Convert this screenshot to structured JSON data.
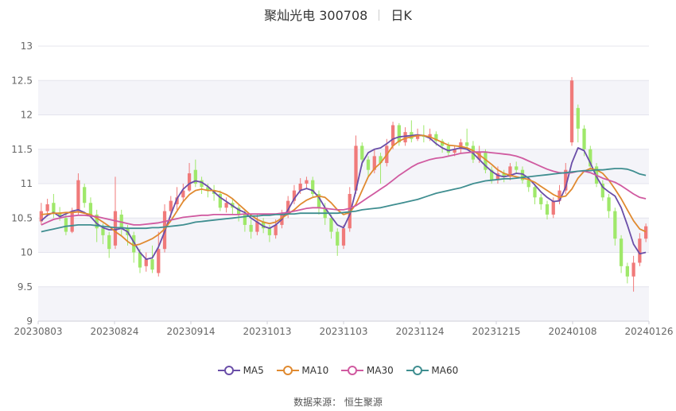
{
  "header": {
    "stock": "聚灿光电 300708",
    "period": "日K"
  },
  "footer": {
    "source_label": "数据来源：",
    "source_name": "恒生聚源"
  },
  "chart_data": {
    "type": "candlestick",
    "ylim": [
      9,
      13
    ],
    "yticks": [
      9,
      9.5,
      10,
      10.5,
      11,
      11.5,
      12,
      12.5,
      13
    ],
    "xticks": [
      "20230803",
      "20230824",
      "20230914",
      "20231013",
      "20231103",
      "20231124",
      "20231215",
      "20240108",
      "20240126"
    ],
    "grid": true,
    "legend_position": "bottom",
    "colors": {
      "up": "#f07a7a",
      "down": "#9fe86a",
      "grid": "#e4e4ee",
      "band": "#f4f4f9"
    },
    "candles": [
      [
        10.45,
        10.6,
        10.72,
        10.4
      ],
      [
        10.6,
        10.7,
        10.78,
        10.52
      ],
      [
        10.72,
        10.58,
        10.85,
        10.5
      ],
      [
        10.58,
        10.52,
        10.66,
        10.46
      ],
      [
        10.5,
        10.3,
        10.56,
        10.25
      ],
      [
        10.3,
        10.6,
        10.65,
        10.28
      ],
      [
        10.6,
        11.05,
        11.15,
        10.55
      ],
      [
        10.95,
        10.72,
        11.0,
        10.65
      ],
      [
        10.72,
        10.55,
        10.8,
        10.5
      ],
      [
        10.55,
        10.35,
        10.62,
        10.15
      ],
      [
        10.35,
        10.25,
        10.42,
        10.12
      ],
      [
        10.25,
        10.05,
        10.3,
        9.92
      ],
      [
        10.1,
        10.6,
        11.1,
        10.05
      ],
      [
        10.55,
        10.35,
        10.62,
        10.25
      ],
      [
        10.35,
        10.25,
        10.4,
        10.1
      ],
      [
        10.25,
        10.0,
        10.3,
        9.85
      ],
      [
        10.0,
        9.78,
        10.05,
        9.7
      ],
      [
        9.8,
        9.9,
        10.0,
        9.72
      ],
      [
        9.9,
        9.75,
        10.1,
        9.7
      ],
      [
        9.7,
        10.05,
        10.3,
        9.65
      ],
      [
        10.05,
        10.6,
        10.7,
        10.0
      ],
      [
        10.6,
        10.75,
        10.82,
        10.5
      ],
      [
        10.7,
        10.8,
        10.95,
        10.62
      ],
      [
        10.8,
        10.9,
        11.0,
        10.75
      ],
      [
        10.9,
        11.15,
        11.3,
        10.88
      ],
      [
        11.2,
        11.0,
        11.35,
        10.95
      ],
      [
        11.05,
        10.95,
        11.1,
        10.85
      ],
      [
        10.95,
        10.9,
        11.0,
        10.8
      ],
      [
        10.9,
        10.85,
        10.98,
        10.75
      ],
      [
        10.85,
        10.65,
        10.9,
        10.6
      ],
      [
        10.65,
        10.72,
        10.8,
        10.58
      ],
      [
        10.72,
        10.65,
        10.78,
        10.55
      ],
      [
        10.65,
        10.55,
        10.7,
        10.45
      ],
      [
        10.55,
        10.4,
        10.62,
        10.3
      ],
      [
        10.4,
        10.3,
        10.48,
        10.2
      ],
      [
        10.3,
        10.45,
        10.55,
        10.25
      ],
      [
        10.45,
        10.35,
        10.5,
        10.28
      ],
      [
        10.35,
        10.25,
        10.4,
        10.15
      ],
      [
        10.25,
        10.4,
        10.48,
        10.2
      ],
      [
        10.4,
        10.55,
        10.62,
        10.35
      ],
      [
        10.55,
        10.75,
        10.82,
        10.5
      ],
      [
        10.75,
        10.9,
        10.98,
        10.7
      ],
      [
        10.9,
        11.0,
        11.08,
        10.85
      ],
      [
        11.0,
        11.05,
        11.1,
        10.92
      ],
      [
        11.05,
        10.85,
        11.1,
        10.8
      ],
      [
        10.85,
        10.65,
        10.9,
        10.55
      ],
      [
        10.65,
        10.5,
        10.72,
        10.4
      ],
      [
        10.5,
        10.3,
        10.55,
        10.2
      ],
      [
        10.3,
        10.1,
        10.35,
        9.95
      ],
      [
        10.1,
        10.35,
        10.4,
        10.05
      ],
      [
        10.35,
        10.85,
        10.95,
        10.3
      ],
      [
        10.9,
        11.55,
        11.7,
        10.85
      ],
      [
        11.55,
        11.35,
        11.6,
        11.25
      ],
      [
        11.35,
        11.2,
        11.4,
        11.1
      ],
      [
        11.2,
        11.4,
        11.5,
        11.15
      ],
      [
        11.4,
        11.3,
        11.45,
        11.0
      ],
      [
        11.3,
        11.55,
        11.65,
        11.25
      ],
      [
        11.55,
        11.85,
        11.9,
        11.5
      ],
      [
        11.85,
        11.6,
        11.88,
        11.55
      ],
      [
        11.6,
        11.75,
        11.82,
        11.55
      ],
      [
        11.75,
        11.65,
        11.92,
        11.6
      ],
      [
        11.65,
        11.7,
        11.8,
        11.62
      ],
      [
        11.7,
        11.68,
        11.85,
        11.6
      ],
      [
        11.68,
        11.72,
        11.8,
        11.62
      ],
      [
        11.72,
        11.62,
        11.76,
        11.55
      ],
      [
        11.62,
        11.55,
        11.65,
        11.45
      ],
      [
        11.55,
        11.45,
        11.6,
        11.4
      ],
      [
        11.45,
        11.5,
        11.55,
        11.4
      ],
      [
        11.5,
        11.6,
        11.65,
        11.45
      ],
      [
        11.6,
        11.55,
        11.8,
        11.5
      ],
      [
        11.55,
        11.35,
        11.62,
        11.3
      ],
      [
        11.35,
        11.45,
        11.55,
        11.3
      ],
      [
        11.45,
        11.2,
        11.5,
        11.15
      ],
      [
        11.2,
        11.05,
        11.25,
        11.0
      ],
      [
        11.05,
        11.15,
        11.25,
        11.0
      ],
      [
        11.15,
        11.1,
        11.2,
        11.02
      ],
      [
        11.1,
        11.25,
        11.3,
        11.05
      ],
      [
        11.25,
        11.2,
        11.32,
        11.15
      ],
      [
        11.2,
        11.05,
        11.25,
        11.0
      ],
      [
        11.05,
        10.95,
        11.1,
        10.88
      ],
      [
        10.95,
        10.8,
        11.0,
        10.7
      ],
      [
        10.8,
        10.7,
        10.85,
        10.62
      ],
      [
        10.7,
        10.55,
        10.75,
        10.48
      ],
      [
        10.55,
        10.75,
        10.8,
        10.5
      ],
      [
        10.75,
        10.9,
        10.98,
        10.7
      ],
      [
        10.9,
        11.2,
        11.3,
        10.85
      ],
      [
        11.6,
        12.5,
        12.55,
        11.55
      ],
      [
        12.1,
        11.8,
        12.15,
        11.6
      ],
      [
        11.8,
        11.5,
        11.85,
        11.4
      ],
      [
        11.5,
        11.25,
        11.55,
        11.2
      ],
      [
        11.25,
        11.0,
        11.3,
        10.95
      ],
      [
        11.0,
        10.8,
        11.05,
        10.75
      ],
      [
        10.8,
        10.6,
        10.85,
        10.5
      ],
      [
        10.6,
        10.2,
        10.65,
        10.1
      ],
      [
        10.2,
        9.8,
        10.25,
        9.7
      ],
      [
        9.8,
        9.65,
        9.85,
        9.55
      ],
      [
        9.65,
        9.85,
        9.95,
        9.43
      ],
      [
        9.85,
        10.2,
        10.28,
        9.8
      ],
      [
        10.2,
        10.38,
        10.42,
        10.15
      ]
    ],
    "series": [
      {
        "name": "MA5",
        "color": "#6a4ea8",
        "values": [
          10.46,
          10.54,
          10.58,
          10.52,
          10.56,
          10.6,
          10.62,
          10.58,
          10.52,
          10.42,
          10.36,
          10.33,
          10.33,
          10.35,
          10.3,
          10.15,
          10.0,
          9.9,
          9.92,
          10.08,
          10.3,
          10.55,
          10.78,
          10.92,
          11.0,
          11.04,
          11.02,
          10.96,
          10.88,
          10.8,
          10.74,
          10.68,
          10.62,
          10.58,
          10.5,
          10.44,
          10.38,
          10.35,
          10.4,
          10.48,
          10.62,
          10.78,
          10.9,
          10.93,
          10.9,
          10.8,
          10.65,
          10.52,
          10.4,
          10.36,
          10.55,
          10.9,
          11.3,
          11.45,
          11.5,
          11.52,
          11.58,
          11.65,
          11.68,
          11.69,
          11.7,
          11.71,
          11.7,
          11.66,
          11.58,
          11.52,
          11.48,
          11.5,
          11.52,
          11.5,
          11.44,
          11.35,
          11.26,
          11.18,
          11.12,
          11.1,
          11.12,
          11.15,
          11.14,
          11.08,
          10.98,
          10.88,
          10.8,
          10.74,
          10.75,
          10.95,
          11.3,
          11.52,
          11.48,
          11.3,
          11.1,
          10.95,
          10.88,
          10.82,
          10.65,
          10.4,
          10.12,
          9.98,
          10.0
        ]
      },
      {
        "name": "MA10",
        "color": "#e08a30",
        "values": [
          10.55,
          10.56,
          10.57,
          10.57,
          10.58,
          10.58,
          10.59,
          10.57,
          10.55,
          10.5,
          10.44,
          10.38,
          10.3,
          10.24,
          10.16,
          10.1,
          10.12,
          10.16,
          10.2,
          10.26,
          10.34,
          10.46,
          10.6,
          10.74,
          10.84,
          10.9,
          10.92,
          10.9,
          10.9,
          10.88,
          10.84,
          10.78,
          10.7,
          10.62,
          10.54,
          10.48,
          10.44,
          10.42,
          10.44,
          10.5,
          10.56,
          10.62,
          10.7,
          10.76,
          10.8,
          10.82,
          10.8,
          10.72,
          10.62,
          10.55,
          10.58,
          10.7,
          10.9,
          11.1,
          11.22,
          11.3,
          11.42,
          11.55,
          11.62,
          11.66,
          11.68,
          11.7,
          11.7,
          11.68,
          11.64,
          11.6,
          11.56,
          11.55,
          11.54,
          11.52,
          11.48,
          11.42,
          11.35,
          11.28,
          11.2,
          11.15,
          11.12,
          11.1,
          11.08,
          11.06,
          11.02,
          10.96,
          10.9,
          10.84,
          10.8,
          10.82,
          10.92,
          11.08,
          11.18,
          11.22,
          11.2,
          11.15,
          11.05,
          10.92,
          10.78,
          10.62,
          10.46,
          10.34,
          10.3
        ]
      },
      {
        "name": "MA30",
        "color": "#d05aa0",
        "values": [
          10.4,
          10.44,
          10.48,
          10.5,
          10.52,
          10.53,
          10.54,
          10.54,
          10.53,
          10.52,
          10.5,
          10.48,
          10.46,
          10.44,
          10.42,
          10.4,
          10.4,
          10.41,
          10.42,
          10.43,
          10.45,
          10.47,
          10.49,
          10.51,
          10.52,
          10.53,
          10.54,
          10.54,
          10.55,
          10.55,
          10.55,
          10.55,
          10.55,
          10.56,
          10.56,
          10.56,
          10.56,
          10.56,
          10.56,
          10.57,
          10.58,
          10.6,
          10.62,
          10.64,
          10.65,
          10.65,
          10.64,
          10.63,
          10.62,
          10.62,
          10.64,
          10.68,
          10.74,
          10.8,
          10.86,
          10.92,
          10.98,
          11.05,
          11.12,
          11.18,
          11.24,
          11.29,
          11.32,
          11.35,
          11.37,
          11.38,
          11.4,
          11.42,
          11.44,
          11.45,
          11.46,
          11.46,
          11.46,
          11.45,
          11.44,
          11.43,
          11.42,
          11.4,
          11.37,
          11.33,
          11.29,
          11.25,
          11.21,
          11.18,
          11.16,
          11.15,
          11.16,
          11.18,
          11.18,
          11.16,
          11.12,
          11.08,
          11.05,
          11.02,
          10.97,
          10.91,
          10.85,
          10.8,
          10.78
        ]
      },
      {
        "name": "MA60",
        "color": "#3f8e90",
        "values": [
          10.3,
          10.32,
          10.34,
          10.36,
          10.38,
          10.39,
          10.4,
          10.4,
          10.4,
          10.39,
          10.38,
          10.37,
          10.36,
          10.36,
          10.35,
          10.35,
          10.35,
          10.35,
          10.36,
          10.36,
          10.37,
          10.38,
          10.39,
          10.4,
          10.42,
          10.44,
          10.45,
          10.46,
          10.47,
          10.48,
          10.49,
          10.5,
          10.51,
          10.52,
          10.53,
          10.53,
          10.54,
          10.54,
          10.55,
          10.55,
          10.56,
          10.56,
          10.57,
          10.57,
          10.57,
          10.57,
          10.57,
          10.57,
          10.57,
          10.58,
          10.59,
          10.6,
          10.62,
          10.63,
          10.64,
          10.65,
          10.67,
          10.69,
          10.71,
          10.73,
          10.75,
          10.77,
          10.8,
          10.83,
          10.86,
          10.88,
          10.9,
          10.92,
          10.94,
          10.97,
          11.0,
          11.02,
          11.04,
          11.05,
          11.06,
          11.07,
          11.07,
          11.08,
          11.09,
          11.1,
          11.11,
          11.12,
          11.13,
          11.14,
          11.15,
          11.16,
          11.17,
          11.18,
          11.19,
          11.19,
          11.2,
          11.2,
          11.21,
          11.22,
          11.22,
          11.21,
          11.18,
          11.14,
          11.12
        ]
      }
    ]
  }
}
